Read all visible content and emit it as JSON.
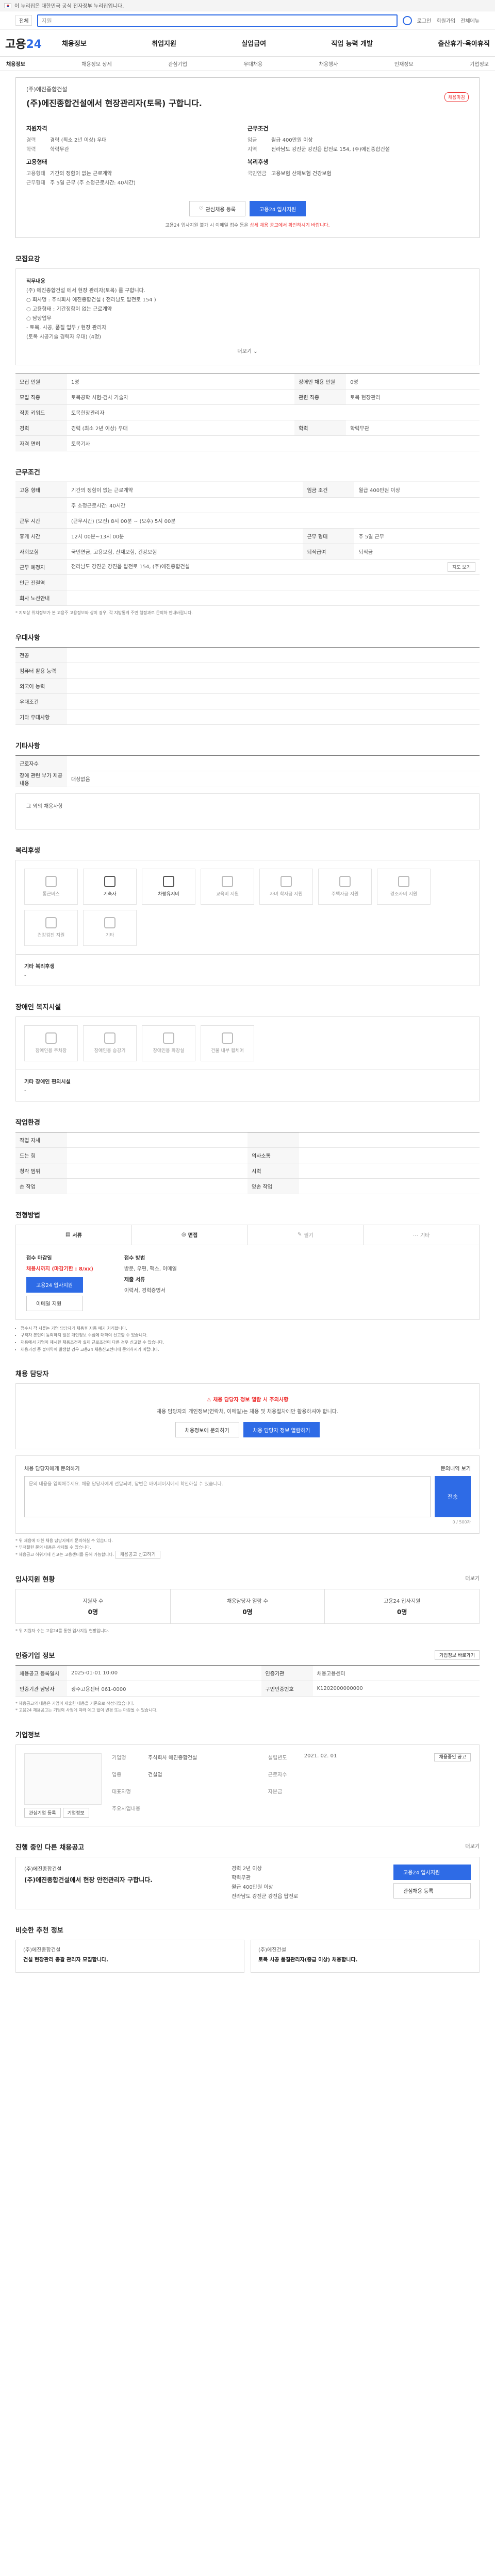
{
  "gov": {
    "banner": "이 누리집은 대한민국 공식 전자정부 누리집입니다."
  },
  "search": {
    "scope": "전체",
    "query": "지원",
    "util": [
      "로그인",
      "회원가입",
      "전체메뉴"
    ]
  },
  "gnb": {
    "logo_a": "고용",
    "logo_b": "24",
    "menu": [
      "채용정보",
      "취업지원",
      "실업급여",
      "직업 능력 개발",
      "출산휴가·육아휴직"
    ]
  },
  "subnav": [
    "채용정보",
    "채용정보 상세",
    "관심기업",
    "우대채용",
    "채용행사",
    "인재정보",
    "기업정보"
  ],
  "job": {
    "company": "(주)에진종합건설",
    "title": "(주)에진종합건설에서 현장관리자(토목) 구합니다.",
    "status": "채용마감",
    "left_h": "지원자격",
    "left": [
      {
        "k": "경력",
        "v": "경력 (최소 2년 이상) 우대"
      },
      {
        "k": "학력",
        "v": "학력무관"
      }
    ],
    "left_h2": "고용형태",
    "left2": [
      {
        "k": "고용형태",
        "v": "기간의 정함이 없는 근로계약"
      },
      {
        "k": "근무형태",
        "v": "주 5일 근무 (주 소정근로시간: 40시간)"
      }
    ],
    "right_h": "근무조건",
    "right": [
      {
        "k": "임금",
        "v": "월급 400만원 이상"
      },
      {
        "k": "지역",
        "v": "전라남도 강진군 강진읍 탑전로 154, (주)에진종합건설"
      }
    ],
    "right_h2": "복리후생",
    "right2": [
      {
        "k": "국민연금",
        "v": "고용보험 산재보험 건강보험"
      }
    ],
    "btn_save": "관심채용 등록",
    "btn_apply": "고용24 입사지원",
    "note": "고용24 입사지원 불가 시 이메일 접수 등은",
    "note_em": "상세 채용 공고에서 확인하시기 바랍니다."
  },
  "recruit": {
    "h": "모집요강",
    "duty_h": "직무내용",
    "lines": [
      "(주) 에진종합건설 에서 현장 관리자(토목) 를 구합니다.",
      "○ 회사명 : 주식회사 에진종합건설 ( 전라남도 탑전로 154 )",
      "○ 고용형태 : 기간정함이 없는 근로계약",
      "○ 담당업무",
      "  - 토목, 시공, 품질 업무 / 현장 관리자",
      "  (토목 시공기술 경력자 우대) (4명)"
    ],
    "more": "더보기"
  },
  "cond_table": [
    [
      {
        "k": "모집 인원",
        "v": "1명"
      },
      {
        "k": "장애인 채용 인원",
        "v": "0명"
      }
    ],
    [
      {
        "k": "모집 직종",
        "v": "토목공학 시험·검사 기술자"
      },
      {
        "k": "관련 직종",
        "v": "토목 현장관리"
      }
    ],
    [
      {
        "k": "직종 키워드",
        "v": "토목현장관리자"
      }
    ],
    [
      {
        "k": "경력",
        "v": "경력 (최소 2년 이상) 우대"
      },
      {
        "k": "학력",
        "v": "학력무관"
      }
    ],
    [
      {
        "k": "자격 면허",
        "v": "토목기사"
      }
    ]
  ],
  "work": {
    "h": "근무조건",
    "rows": [
      {
        "k": "고용 형태",
        "v": "기간의 정함이 없는 근로계약",
        "k2": "임금 조건",
        "v2": "월급 400만원 이상"
      },
      {
        "k": "",
        "v": "주 소정근로시간: 40시간"
      },
      {
        "k": "근무 시간",
        "v": "(근무시간) (오전) 8시 00분 ~ (오후) 5시 00분"
      },
      {
        "k": "휴게 시간",
        "v": "12시 00분~13시 00분",
        "k2": "근무 형태",
        "v2": "주 5일 근무"
      },
      {
        "k": "사회보험",
        "v": "국민연금, 고용보험, 산재보험, 건강보험",
        "k2": "퇴직급여",
        "v2": "퇴직금"
      },
      {
        "k": "근무 예정지",
        "v": "전라남도 강진군 강진읍 탑전로 154, (주)에진종합건설",
        "btn": "지도 보기"
      },
      {
        "k": "인근 전철역",
        "v": ""
      },
      {
        "k": "회사 노선안내",
        "v": ""
      }
    ],
    "note": "* 지도상 위치정보가 본 고용주 고용정보와 상이 경우, 각 지방통계 주민 행정과로 문의하 안내바랍니다."
  },
  "pref": {
    "h": "우대사항",
    "rows": [
      "전공",
      "컴퓨터 활용 능력",
      "외국어 능력",
      "우대조건",
      "기타 우대사항"
    ]
  },
  "etc": {
    "h": "기타사항",
    "rows": [
      {
        "k": "근로자수",
        "v": ""
      },
      {
        "k": "장애 관련 부가 제공 내용",
        "v": "대상없음"
      }
    ],
    "box": "그 외의 채용사항"
  },
  "welfare": {
    "h": "복리후생",
    "items": [
      {
        "name": "통근버스",
        "on": false
      },
      {
        "name": "기숙사",
        "on": true
      },
      {
        "name": "차량유지비",
        "on": true
      },
      {
        "name": "교육비 지원",
        "on": false
      },
      {
        "name": "자녀 학자금 지원",
        "on": false
      },
      {
        "name": "주택자금 지원",
        "on": false
      },
      {
        "name": "경조사비 지원",
        "on": false
      },
      {
        "name": "건강검진 지원",
        "on": false
      },
      {
        "name": "기타",
        "on": false
      }
    ],
    "sub_h": "기타 복리후생",
    "sub": "-"
  },
  "disab": {
    "h": "장애인 복지시설",
    "items": [
      "장애인용 주차장",
      "장애인용 승강기",
      "장애인용 화장실",
      "건물 내부 휠체어"
    ],
    "sub_h": "기타 장애인 편의시설",
    "sub": "-"
  },
  "environ": {
    "h": "작업환경",
    "rows": [
      {
        "k": "작업 자세",
        "v": "",
        "k2": "",
        "v2": ""
      },
      {
        "k": "드는 힘",
        "v": "",
        "k2": "의사소통",
        "v2": ""
      },
      {
        "k": "청각 범위",
        "v": "",
        "k2": "시력",
        "v2": ""
      },
      {
        "k": "손 작업",
        "v": "",
        "k2": "양손 작업",
        "v2": ""
      }
    ]
  },
  "select": {
    "h": "전형방법",
    "steps": [
      {
        "n": "서류",
        "on": true
      },
      {
        "n": "면접",
        "on": true
      },
      {
        "n": "필기",
        "on": false
      },
      {
        "n": "기타",
        "on": false
      }
    ],
    "apply_h": "접수 마감일",
    "deadline": "채용시까지 (마감기한 : 8/xx)",
    "btn_apply": "고용24 입사지원",
    "btn_email": "이메일 지원",
    "method_h": "접수 방법",
    "method": "방문, 우편, 팩스, 이메일",
    "docs_h": "제출 서류",
    "docs": "이력서, 경력증명서",
    "notices": [
      "접수시 각 서류는 기업 담당자가 채용후 자동 폐기 처리합니다.",
      "구직자 본인이 동의하지 않은 개인정보 수집에 대하여 신고할 수 있습니다.",
      "채용에서 기업이 제시한 채용조건과 실제 근로조건이 다른 경우 신고할 수 있습니다.",
      "채용과정 중 불이익이 발생할 경우 고용24 채용신고센터에 문의하시기 바랍니다."
    ]
  },
  "manager": {
    "h": "채용 담당자",
    "warn": "채용 담당자 정보 열람 시 주의사항",
    "text": "채용 담당자의 개인정보(연락처, 이메일)는 채용 및 채용절차에만 활용하셔야 합니다.",
    "btn1": "채용정보에 문의하기",
    "btn2": "채용 담당자 정보 열람하기",
    "qa_label": "채용 담당자에게 문의하기",
    "qa_link": "문의내역 보기",
    "qa_placeholder": "문의 내용을 입력해주세요. 채용 담당자에게 전달되며, 답변은 마이페이지에서 확인하실 수 있습니다.",
    "qa_send": "전송",
    "qa_count": "0 / 500자",
    "notes": [
      "* 위 채용에 대한 채용 담당자에게 문의하실 수 있습니다.",
      "* 부적절한 문의 내용은 삭제될 수 있습니다.",
      "* 채용공고 허위기재 신고는 고용센터를 통해 가능합니다."
    ],
    "notes_btn": "채용공고 신고하기"
  },
  "applicants": {
    "h": "입사지원 현황",
    "more": "더보기",
    "stats": [
      {
        "k": "지원자 수",
        "v": "0명"
      },
      {
        "k": "채용담당자 열람 수",
        "v": "0명"
      },
      {
        "k": "고용24 입사지원",
        "v": "0명"
      }
    ],
    "note": "* 위 지원자 수는 고용24를 통한 입사지원 현황입니다."
  },
  "reginfo": {
    "h": "인증기업 정보",
    "btn": "기업정보 바로가기",
    "rows": [
      {
        "k": "채용공고 등록일시",
        "v": "2025-01-01 10:00",
        "k2": "인증기관",
        "v2": "채용고용센터"
      },
      {
        "k": "인증기관 담당자",
        "v": "광주고용센터 061-0000",
        "k2": "구인인증번호",
        "v2": "K1202000000000"
      }
    ],
    "notes": [
      "* 채용공고의 내용은 기업이 제출한 내용을 기준으로 작성되었습니다.",
      "* 고용24 채용공고는 기업의 사정에 따라 예고 없이 변경 또는 마감될 수 있습니다."
    ]
  },
  "company": {
    "h": "기업정보",
    "grid": [
      {
        "k": "기업명",
        "v": "주식회사 에진종합건설"
      },
      {
        "k": "설립년도",
        "v": "2021. 02. 01"
      },
      {
        "k": "업종",
        "v": "건설업"
      },
      {
        "k": "근로자수",
        "v": ""
      },
      {
        "k": "대표자명",
        "v": ""
      },
      {
        "k": "자본금",
        "v": ""
      },
      {
        "k": "주요사업내용",
        "v": ""
      },
      {
        "k": "",
        "v": ""
      }
    ],
    "btn": "채용중인 공고",
    "btn_a": "관심기업 등록",
    "btn_b": "기업정보"
  },
  "other": {
    "h": "진행 중인 다른 채용공고",
    "more": "더보기",
    "co": "(주)에진종합건설",
    "title": "(주)에진종합건설에서 현장 안전관리자 구합니다.",
    "m": [
      "경력 2년 이상",
      "학력무관",
      "월급 400만원 이상",
      "전라남도 강진군 강진읍 탑전로"
    ],
    "btn1": "고용24 입사지원",
    "btn2": "관심채용 등록"
  },
  "similar": {
    "h": "비슷한 추천 정보",
    "cards": [
      {
        "c": "(주)에진종합건설",
        "t": "건설 현장관리 총괄 관리자 모집합니다."
      },
      {
        "c": "(주)에진건설",
        "t": "토목 시공 품질관리자(중급 이상) 채용합니다."
      }
    ]
  }
}
